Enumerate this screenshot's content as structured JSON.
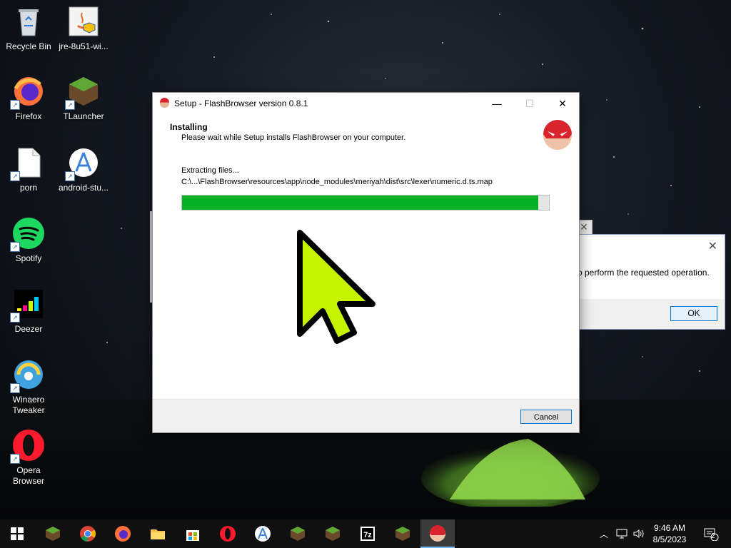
{
  "desktop": {
    "icons": [
      {
        "label": "Recycle Bin"
      },
      {
        "label": "jre-8u51-wi..."
      },
      {
        "label": "Firefox"
      },
      {
        "label": "TLauncher"
      },
      {
        "label": "porn"
      },
      {
        "label": "android-stu..."
      },
      {
        "label": "Spotify"
      },
      {
        "label": "Deezer"
      },
      {
        "label": "Winaero Tweaker"
      },
      {
        "label": "Opera Browser"
      }
    ]
  },
  "background_dialog": {
    "message": "o perform the requested operation.",
    "ok_label": "OK",
    "close_glyph": "✕"
  },
  "setup": {
    "title": "Setup - FlashBrowser version 0.8.1",
    "heading": "Installing",
    "subheading": "Please wait while Setup installs FlashBrowser on your computer.",
    "status": "Extracting files...",
    "path": "C:\\...\\FlashBrowser\\resources\\app\\node_modules\\meriyah\\dist\\src\\lexer\\numeric.d.ts.map",
    "progress": 0.97,
    "cancel_label": "Cancel",
    "colors": {
      "progress": "#06b025",
      "accent": "#0078d7"
    }
  },
  "taskbar": {
    "apps": [
      "start",
      "minecraft",
      "chrome",
      "firefox",
      "file-explorer",
      "store",
      "opera",
      "android-studio",
      "minecraft",
      "minecraft",
      "7zip",
      "minecraft",
      "flashbrowser"
    ],
    "time": "9:46 AM",
    "date": "8/5/2023",
    "notifications": "2"
  }
}
